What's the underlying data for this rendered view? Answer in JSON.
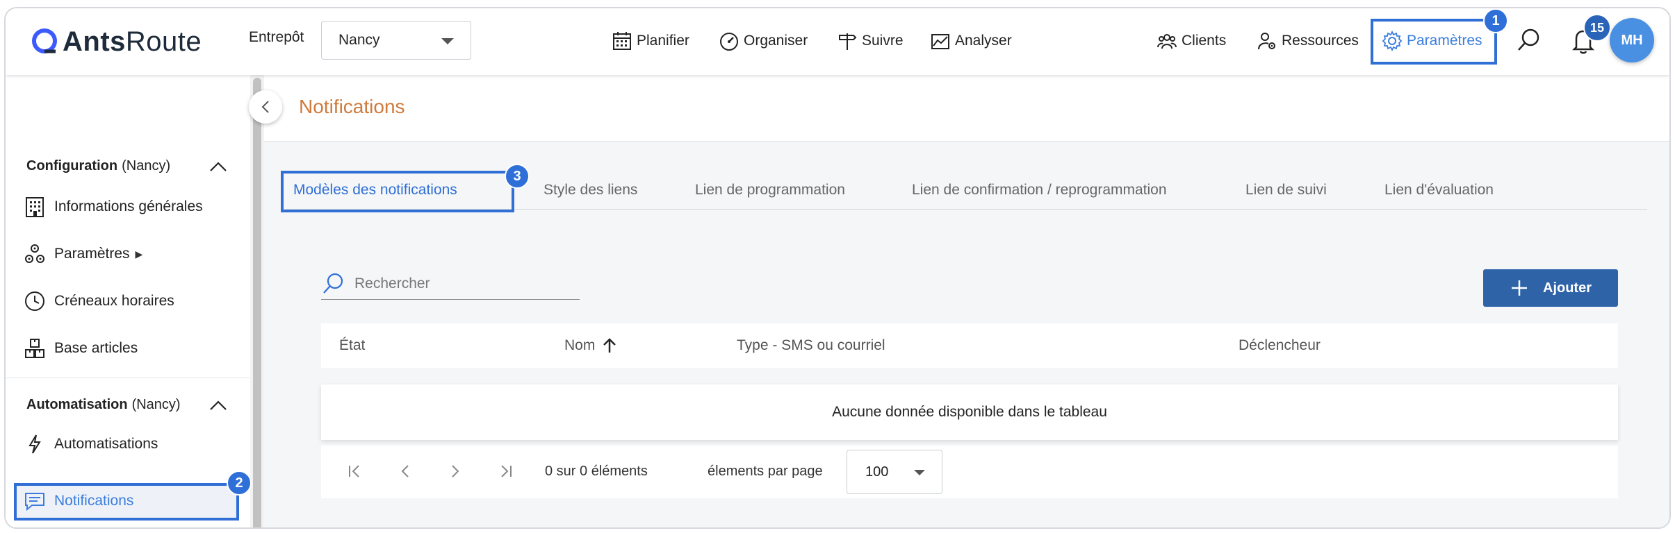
{
  "app": {
    "logo_bold": "Ants",
    "logo_light": "Route"
  },
  "header": {
    "warehouse_label": "Entrepôt",
    "warehouse_value": "Nancy",
    "nav": [
      {
        "label": "Planifier",
        "icon": "calendar-icon"
      },
      {
        "label": "Organiser",
        "icon": "speedometer-icon"
      },
      {
        "label": "Suivre",
        "icon": "signpost-icon"
      },
      {
        "label": "Analyser",
        "icon": "chart-icon"
      }
    ],
    "right_nav": [
      {
        "label": "Clients",
        "icon": "people-icon"
      },
      {
        "label": "Ressources",
        "icon": "user-gear-icon"
      },
      {
        "label": "Paramètres",
        "icon": "gear-icon"
      }
    ],
    "notification_count": "15",
    "avatar_initials": "MH"
  },
  "annotations": {
    "step1": "1",
    "step2": "2",
    "step3": "3"
  },
  "sidebar": {
    "sections": [
      {
        "title": "Configuration",
        "context": "(Nancy)"
      },
      {
        "title": "Automatisation",
        "context": "(Nancy)"
      }
    ],
    "items": [
      {
        "label": "Informations générales"
      },
      {
        "label": "Paramètres",
        "suffix": "▶"
      },
      {
        "label": "Créneaux horaires"
      },
      {
        "label": "Base articles"
      },
      {
        "label": "Automatisations"
      },
      {
        "label": "Notifications"
      }
    ]
  },
  "main": {
    "title": "Notifications",
    "tabs": [
      "Modèles des notifications",
      "Style des liens",
      "Lien de programmation",
      "Lien de confirmation / reprogrammation",
      "Lien de suivi",
      "Lien d'évaluation"
    ],
    "search_placeholder": "Rechercher",
    "add_label": "Ajouter",
    "columns": [
      "État",
      "Nom",
      "Type - SMS ou courriel",
      "Déclencheur"
    ],
    "empty_message": "Aucune donnée disponible dans le tableau",
    "pager": {
      "count_text": "0 sur 0 éléments",
      "per_page_label": "élements par page",
      "per_page_value": "100"
    }
  },
  "colors": {
    "accent": "#2f6fd6",
    "title": "#cf7a3c",
    "button": "#2f63a8"
  }
}
